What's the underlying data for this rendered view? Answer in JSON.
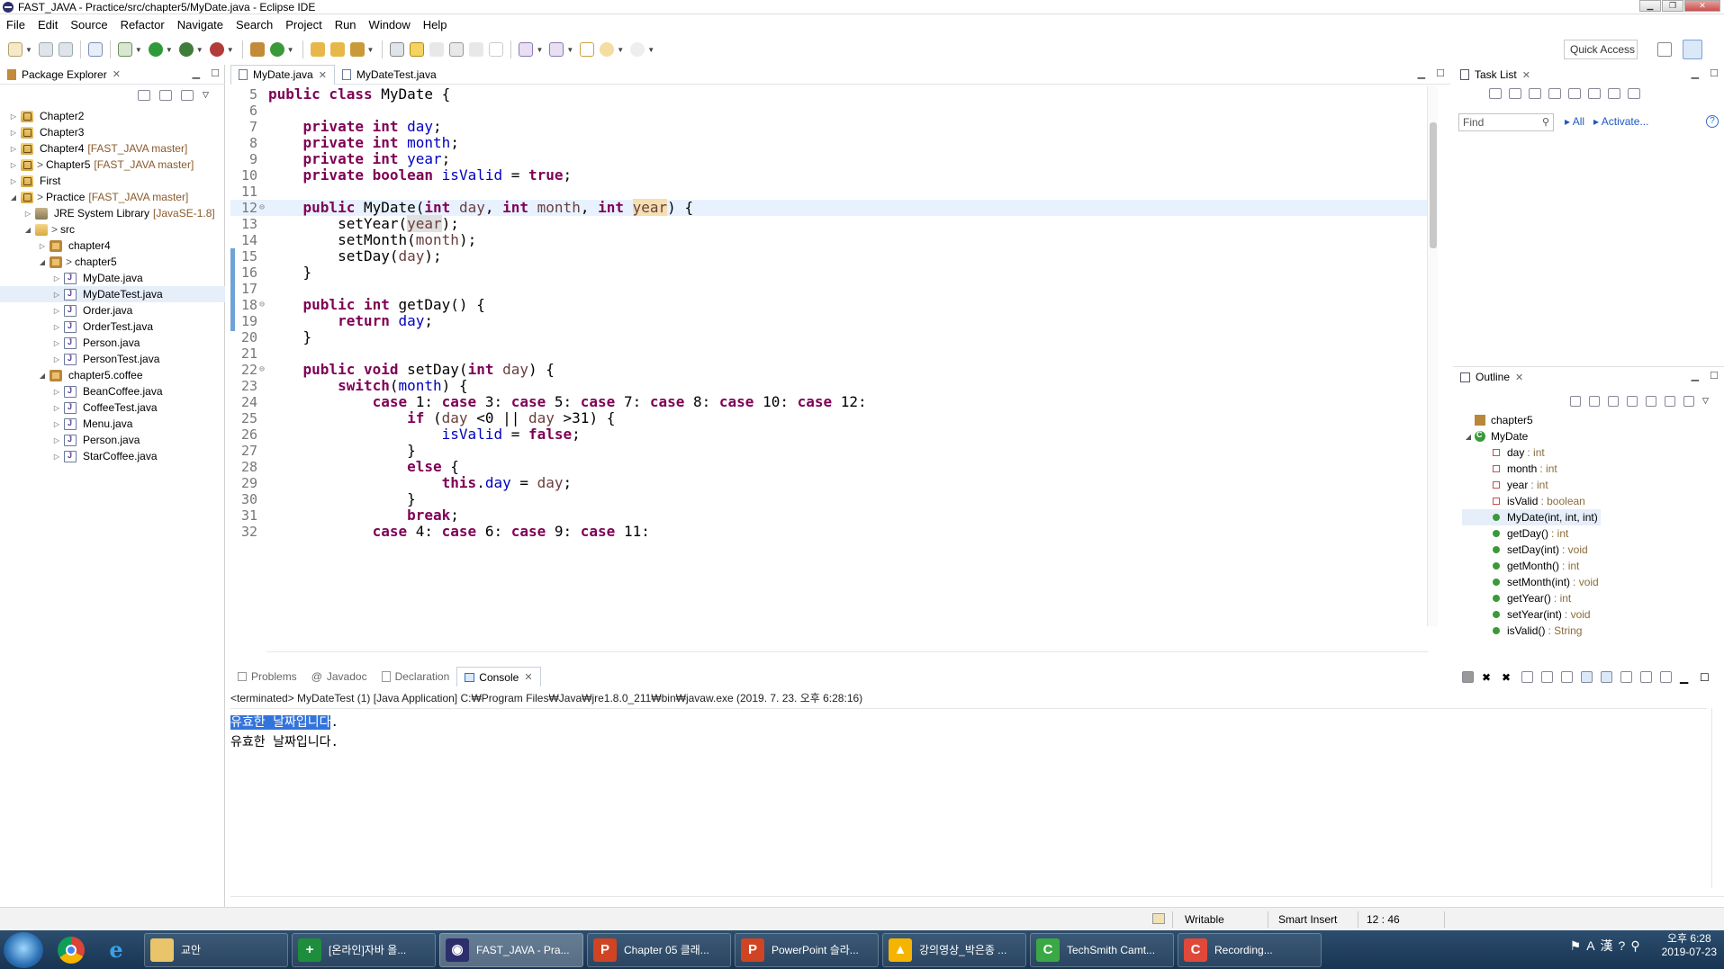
{
  "window": {
    "title": "FAST_JAVA - Practice/src/chapter5/MyDate.java - Eclipse IDE"
  },
  "menu": [
    "File",
    "Edit",
    "Source",
    "Refactor",
    "Navigate",
    "Search",
    "Project",
    "Run",
    "Window",
    "Help"
  ],
  "toolbar": {
    "quick_access": "Quick Access"
  },
  "package_explorer": {
    "title": "Package Explorer",
    "items": [
      {
        "label": "Chapter2",
        "decoration": "",
        "dirty": "",
        "level": 0,
        "twisty": "▷",
        "icon": "project-icon"
      },
      {
        "label": "Chapter3",
        "decoration": "",
        "dirty": "",
        "level": 0,
        "twisty": "▷",
        "icon": "project-icon"
      },
      {
        "label": "Chapter4",
        "decoration": "[FAST_JAVA master]",
        "dirty": "",
        "level": 0,
        "twisty": "▷",
        "icon": "project-icon"
      },
      {
        "label": "Chapter5",
        "decoration": "[FAST_JAVA master]",
        "dirty": ">",
        "level": 0,
        "twisty": "▷",
        "icon": "project-icon"
      },
      {
        "label": "First",
        "decoration": "",
        "dirty": "",
        "level": 0,
        "twisty": "▷",
        "icon": "project-icon"
      },
      {
        "label": "Practice",
        "decoration": "[FAST_JAVA master]",
        "dirty": ">",
        "level": 0,
        "twisty": "◢",
        "icon": "project-icon"
      },
      {
        "label": "JRE System Library",
        "decoration": "[JavaSE-1.8]",
        "dirty": "",
        "level": 1,
        "twisty": "▷",
        "icon": "library-icon"
      },
      {
        "label": "src",
        "decoration": "",
        "dirty": ">",
        "level": 1,
        "twisty": "◢",
        "icon": "source-folder-icon"
      },
      {
        "label": "chapter4",
        "decoration": "",
        "dirty": "",
        "level": 2,
        "twisty": "▷",
        "icon": "package-icon"
      },
      {
        "label": "chapter5",
        "decoration": "",
        "dirty": ">",
        "level": 2,
        "twisty": "◢",
        "icon": "package-icon"
      },
      {
        "label": "MyDate.java",
        "decoration": "",
        "dirty": "",
        "level": 3,
        "twisty": "▷",
        "icon": "java-file-icon"
      },
      {
        "label": "MyDateTest.java",
        "decoration": "",
        "dirty": "",
        "level": 3,
        "twisty": "▷",
        "icon": "java-file-icon",
        "selected": true
      },
      {
        "label": "Order.java",
        "decoration": "",
        "dirty": "",
        "level": 3,
        "twisty": "▷",
        "icon": "java-file-icon"
      },
      {
        "label": "OrderTest.java",
        "decoration": "",
        "dirty": "",
        "level": 3,
        "twisty": "▷",
        "icon": "java-file-icon"
      },
      {
        "label": "Person.java",
        "decoration": "",
        "dirty": "",
        "level": 3,
        "twisty": "▷",
        "icon": "java-file-icon"
      },
      {
        "label": "PersonTest.java",
        "decoration": "",
        "dirty": "",
        "level": 3,
        "twisty": "▷",
        "icon": "java-file-icon"
      },
      {
        "label": "chapter5.coffee",
        "decoration": "",
        "dirty": "",
        "level": 2,
        "twisty": "◢",
        "icon": "package-icon"
      },
      {
        "label": "BeanCoffee.java",
        "decoration": "",
        "dirty": "",
        "level": 3,
        "twisty": "▷",
        "icon": "java-file-icon"
      },
      {
        "label": "CoffeeTest.java",
        "decoration": "",
        "dirty": "",
        "level": 3,
        "twisty": "▷",
        "icon": "java-file-icon"
      },
      {
        "label": "Menu.java",
        "decoration": "",
        "dirty": "",
        "level": 3,
        "twisty": "▷",
        "icon": "java-file-icon"
      },
      {
        "label": "Person.java",
        "decoration": "",
        "dirty": "",
        "level": 3,
        "twisty": "▷",
        "icon": "java-file-icon"
      },
      {
        "label": "StarCoffee.java",
        "decoration": "",
        "dirty": "",
        "level": 3,
        "twisty": "▷",
        "icon": "java-file-icon"
      }
    ]
  },
  "editor": {
    "tabs": [
      {
        "label": "MyDate.java",
        "active": true
      },
      {
        "label": "MyDateTest.java",
        "active": false
      }
    ],
    "current_line": 12,
    "lines": [
      {
        "n": "5",
        "fold": "",
        "html": "<span class=\"kw\">public class</span> MyDate {"
      },
      {
        "n": "6",
        "fold": "",
        "html": ""
      },
      {
        "n": "7",
        "fold": "",
        "html": "    <span class=\"kw\">private int</span> <span class=\"fld\">day</span>;"
      },
      {
        "n": "8",
        "fold": "",
        "html": "    <span class=\"kw\">private int</span> <span class=\"fld\">month</span>;"
      },
      {
        "n": "9",
        "fold": "",
        "html": "    <span class=\"kw\">private int</span> <span class=\"fld\">year</span>;"
      },
      {
        "n": "10",
        "fold": "",
        "html": "    <span class=\"kw\">private boolean</span> <span class=\"fld\">isValid</span> = <span class=\"kw\">true</span>;"
      },
      {
        "n": "11",
        "fold": "",
        "html": ""
      },
      {
        "n": "12",
        "fold": "⊖",
        "html": "    <span class=\"kw\">public</span> MyDate(<span class=\"kw\">int</span> <span class=\"prm\">day</span>, <span class=\"kw\">int</span> <span class=\"prm\">month</span>, <span class=\"kw\">int</span> <span class=\"prm hl\">year</span>) {"
      },
      {
        "n": "13",
        "fold": "",
        "html": "        setYear(<span class=\"prm hl2\">year</span>);"
      },
      {
        "n": "14",
        "fold": "",
        "html": "        setMonth(<span class=\"prm\">month</span>);"
      },
      {
        "n": "15",
        "fold": "",
        "html": "        setDay(<span class=\"prm\">day</span>);"
      },
      {
        "n": "16",
        "fold": "",
        "html": "    }"
      },
      {
        "n": "17",
        "fold": "",
        "html": ""
      },
      {
        "n": "18",
        "fold": "⊖",
        "html": "    <span class=\"kw\">public int</span> getDay() {"
      },
      {
        "n": "19",
        "fold": "",
        "html": "        <span class=\"kw\">return</span> <span class=\"fld\">day</span>;"
      },
      {
        "n": "20",
        "fold": "",
        "html": "    }"
      },
      {
        "n": "21",
        "fold": "",
        "html": ""
      },
      {
        "n": "22",
        "fold": "⊖",
        "html": "    <span class=\"kw\">public void</span> setDay(<span class=\"kw\">int</span> <span class=\"prm\">day</span>) {"
      },
      {
        "n": "23",
        "fold": "",
        "html": "        <span class=\"kw\">switch</span>(<span class=\"fld\">month</span>) {"
      },
      {
        "n": "24",
        "fold": "",
        "html": "            <span class=\"kw\">case</span> 1: <span class=\"kw\">case</span> 3: <span class=\"kw\">case</span> 5: <span class=\"kw\">case</span> 7: <span class=\"kw\">case</span> 8: <span class=\"kw\">case</span> 10: <span class=\"kw\">case</span> 12:"
      },
      {
        "n": "25",
        "fold": "",
        "html": "                <span class=\"kw\">if</span> (<span class=\"prm\">day</span> &lt;0 || <span class=\"prm\">day</span> &gt;31) {"
      },
      {
        "n": "26",
        "fold": "",
        "html": "                    <span class=\"fld\">isValid</span> = <span class=\"kw\">false</span>;"
      },
      {
        "n": "27",
        "fold": "",
        "html": "                }"
      },
      {
        "n": "28",
        "fold": "",
        "html": "                <span class=\"kw\">else</span> {"
      },
      {
        "n": "29",
        "fold": "",
        "html": "                    <span class=\"kw\">this</span>.<span class=\"fld\">day</span> = <span class=\"prm\">day</span>;"
      },
      {
        "n": "30",
        "fold": "",
        "html": "                }"
      },
      {
        "n": "31",
        "fold": "",
        "html": "                <span class=\"kw\">break</span>;"
      },
      {
        "n": "32",
        "fold": "",
        "html": "            <span class=\"kw\">case</span> 4: <span class=\"kw\">case</span> 6: <span class=\"kw\">case</span> 9: <span class=\"kw\">case</span> 11:"
      }
    ]
  },
  "task_list": {
    "title": "Task List",
    "find_placeholder": "Find",
    "all": "All",
    "activate": "Activate...",
    "help": "?"
  },
  "outline": {
    "title": "Outline",
    "items": [
      {
        "label": "chapter5",
        "type": "",
        "icon": "package-icon",
        "twisty": ""
      },
      {
        "label": "MyDate",
        "type": "",
        "icon": "class-icon",
        "twisty": "◢"
      },
      {
        "label": "day",
        "type": ": int",
        "icon": "private-field-icon",
        "twisty": ""
      },
      {
        "label": "month",
        "type": ": int",
        "icon": "private-field-icon",
        "twisty": ""
      },
      {
        "label": "year",
        "type": ": int",
        "icon": "private-field-icon",
        "twisty": ""
      },
      {
        "label": "isValid",
        "type": ": boolean",
        "icon": "private-field-icon",
        "twisty": ""
      },
      {
        "label": "MyDate(int, int, int)",
        "type": "",
        "icon": "constructor-icon",
        "twisty": "",
        "selected": true
      },
      {
        "label": "getDay()",
        "type": ": int",
        "icon": "public-method-icon",
        "twisty": ""
      },
      {
        "label": "setDay(int)",
        "type": ": void",
        "icon": "public-method-icon",
        "twisty": ""
      },
      {
        "label": "getMonth()",
        "type": ": int",
        "icon": "public-method-icon",
        "twisty": ""
      },
      {
        "label": "setMonth(int)",
        "type": ": void",
        "icon": "public-method-icon",
        "twisty": ""
      },
      {
        "label": "getYear()",
        "type": ": int",
        "icon": "public-method-icon",
        "twisty": ""
      },
      {
        "label": "setYear(int)",
        "type": ": void",
        "icon": "public-method-icon",
        "twisty": ""
      },
      {
        "label": "isValid()",
        "type": ": String",
        "icon": "public-method-icon",
        "twisty": ""
      }
    ]
  },
  "console": {
    "tabs": [
      {
        "label": "Problems",
        "active": false
      },
      {
        "label": "Javadoc",
        "active": false
      },
      {
        "label": "Declaration",
        "active": false
      },
      {
        "label": "Console",
        "active": true
      }
    ],
    "status": "<terminated> MyDateTest (1) [Java Application] C:₩Program Files₩Java₩jre1.8.0_211₩bin₩javaw.exe (2019. 7. 23. 오후 6:28:16)",
    "output": [
      "유효한 날짜입니다.",
      "유효한 날짜입니다."
    ],
    "selected_text": "유효한 날짜입니다"
  },
  "statusbar": {
    "writable": "Writable",
    "insert_mode": "Smart Insert",
    "position": "12 : 46"
  },
  "taskbar": {
    "items": [
      {
        "label": "교안",
        "icon_color": "#e9c46a",
        "glyph": "",
        "active": false
      },
      {
        "label": "[온라인]자바 올...",
        "icon_color": "#1e8e3e",
        "glyph": "+",
        "active": false
      },
      {
        "label": "FAST_JAVA - Pra...",
        "icon_color": "#2c2f6b",
        "glyph": "◉",
        "active": true
      },
      {
        "label": "Chapter 05 클래...",
        "icon_color": "#d04423",
        "glyph": "P",
        "active": false
      },
      {
        "label": "PowerPoint 슬라...",
        "icon_color": "#d04423",
        "glyph": "P",
        "active": false
      },
      {
        "label": "강의영상_박은종 ...",
        "icon_color": "#f4b400",
        "glyph": "▲",
        "active": false
      },
      {
        "label": "TechSmith Camt...",
        "icon_color": "#3aa845",
        "glyph": "C",
        "active": false
      },
      {
        "label": "Recording...",
        "icon_color": "#e0493a",
        "glyph": "C",
        "active": false
      }
    ],
    "time": "오후 6:28",
    "date": "2019-07-23"
  }
}
